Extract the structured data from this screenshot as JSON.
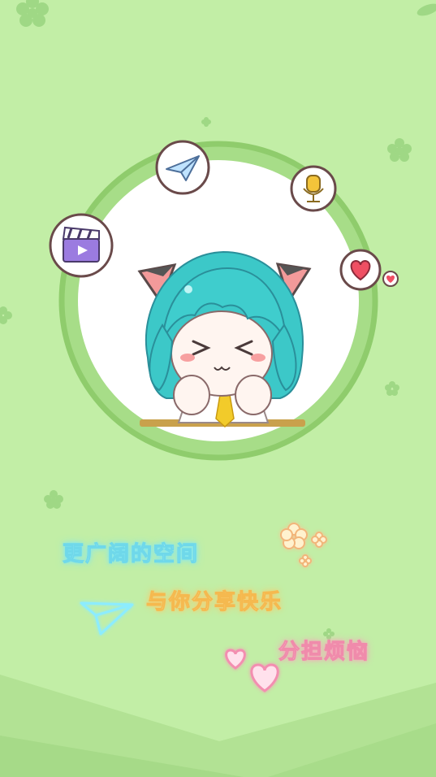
{
  "splash": {
    "taglines": [
      "更广阔的空间",
      "与你分享快乐",
      "分担烦恼"
    ]
  },
  "icons": {
    "paper_plane": "paper-plane-icon",
    "clapperboard": "clapperboard-icon",
    "microphone": "microphone-icon",
    "heart": "heart-icon",
    "flowers": "flower-doodle-icon",
    "neon_plane": "neon-paper-plane-icon",
    "neon_hearts": "neon-hearts-icon"
  },
  "colors": {
    "background": "#c2eea6",
    "ring": "#8fcc6c",
    "tagline_1": "#6fd8ea",
    "tagline_2": "#f5b94f",
    "tagline_3": "#f08bab"
  }
}
